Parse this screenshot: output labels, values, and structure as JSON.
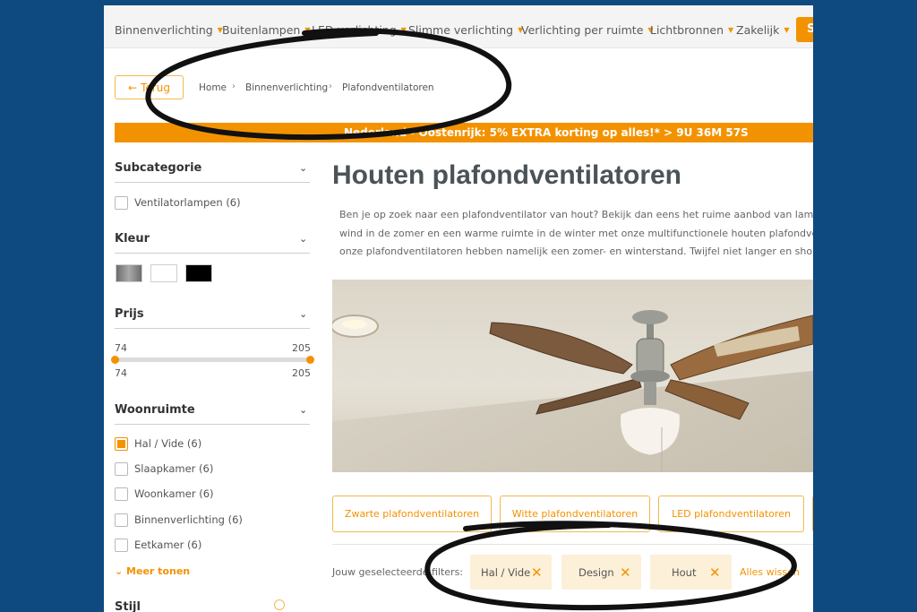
{
  "nav": {
    "items": [
      {
        "label": "Binnenverlichting"
      },
      {
        "label": "Buitenlampen"
      },
      {
        "label": "LED verlichting"
      },
      {
        "label": "Slimme verlichting"
      },
      {
        "label": "Verlichting per ruimte"
      },
      {
        "label": "Lichtbronnen"
      },
      {
        "label": "Zakelijk"
      }
    ],
    "cta_label": "S"
  },
  "back_label": "Terug",
  "breadcrumb": [
    "Home",
    "Binnenverlichting",
    "Plafondventilatoren"
  ],
  "promo_text": "Nederland - Oostenrijk: 5% EXTRA korting op alles!* > 9U 36M 57S",
  "sidebar": {
    "subcategorie": {
      "title": "Subcategorie",
      "items": [
        {
          "label": "Ventilatorlampen (6)"
        }
      ]
    },
    "kleur": {
      "title": "Kleur",
      "swatches": [
        "#8a8a8a",
        "#ffffff",
        "#000000"
      ]
    },
    "prijs": {
      "title": "Prijs",
      "min": "74",
      "max": "205",
      "min_value": "74",
      "max_value": "205"
    },
    "woonruimte": {
      "title": "Woonruimte",
      "items": [
        {
          "label": "Hal / Vide (6)",
          "checked": true
        },
        {
          "label": "Slaapkamer (6)",
          "checked": false
        },
        {
          "label": "Woonkamer (6)",
          "checked": false
        },
        {
          "label": "Binnenverlichting (6)",
          "checked": false
        },
        {
          "label": "Eetkamer (6)",
          "checked": false
        }
      ],
      "more_label": "Meer tonen"
    },
    "stijl": {
      "title": "Stijl"
    }
  },
  "main": {
    "title": "Houten plafondventilatoren",
    "intro_lines": [
      "Ben je op zoek naar een plafondventilator van hout? Bekijk dan eens het ruime aanbod van lampen",
      "wind in de zomer en een warme ruimte in de winter met onze multifunctionele houten plafondventi",
      "onze plafondventilatoren hebben namelijk een zomer- en winterstand. Twijfel niet langer en shop n"
    ],
    "category_buttons": [
      {
        "label": "Zwarte plafondventilatoren"
      },
      {
        "label": "Witte plafondventilatoren"
      },
      {
        "label": "LED plafondventilatoren"
      }
    ],
    "selected_filters_label": "Jouw geselecteerde filters:",
    "chips": [
      {
        "label": "Hal / Vide"
      },
      {
        "label": "Design"
      },
      {
        "label": "Hout"
      }
    ],
    "clear_all_label": "Alles wissen"
  },
  "colors": {
    "accent": "#f39200",
    "background": "#0e4a7f",
    "heading": "#4a5358"
  }
}
